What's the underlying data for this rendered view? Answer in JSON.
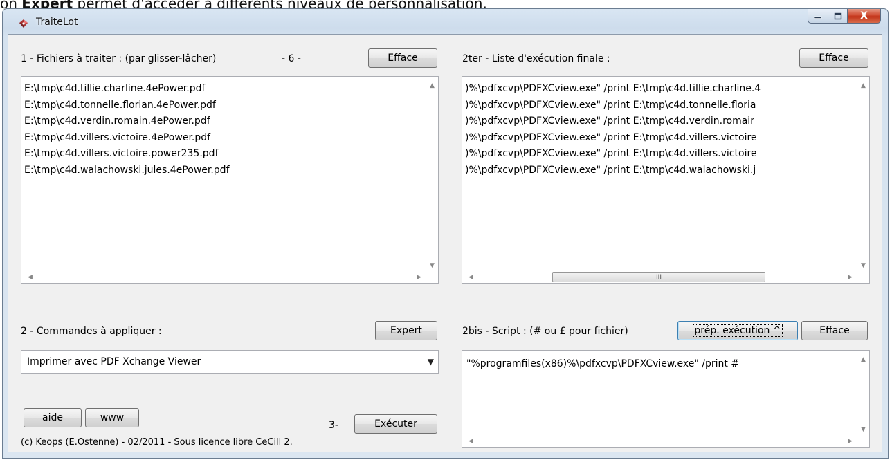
{
  "doc_line": {
    "prefix": "on ",
    "bold": "Expert",
    "suffix": " permet d'accéder à différents niveaux de personnalisation."
  },
  "window": {
    "title": "TraiteLot",
    "close_glyph": "X"
  },
  "files_panel": {
    "label": "1 - Fichiers à traiter : (par glisser-lâcher)",
    "count": "- 6 -",
    "clear_button": "Efface",
    "items": [
      "E:\\tmp\\c4d.tillie.charline.4ePower.pdf",
      "E:\\tmp\\c4d.tonnelle.florian.4ePower.pdf",
      "E:\\tmp\\c4d.verdin.romain.4ePower.pdf",
      "E:\\tmp\\c4d.villers.victoire.4ePower.pdf",
      "E:\\tmp\\c4d.villers.victoire.power235.pdf",
      "E:\\tmp\\c4d.walachowski.jules.4ePower.pdf"
    ]
  },
  "final_panel": {
    "label": "2ter - Liste d'exécution finale :",
    "clear_button": "Efface",
    "items": [
      ")%\\pdfxcvp\\PDFXCview.exe\" /print E:\\tmp\\c4d.tillie.charline.4",
      ")%\\pdfxcvp\\PDFXCview.exe\" /print E:\\tmp\\c4d.tonnelle.floria",
      ")%\\pdfxcvp\\PDFXCview.exe\" /print E:\\tmp\\c4d.verdin.romair",
      ")%\\pdfxcvp\\PDFXCview.exe\" /print E:\\tmp\\c4d.villers.victoire",
      ")%\\pdfxcvp\\PDFXCview.exe\" /print E:\\tmp\\c4d.villers.victoire",
      ")%\\pdfxcvp\\PDFXCview.exe\" /print E:\\tmp\\c4d.walachowski.j"
    ],
    "thumb_glyph": "III"
  },
  "commands_panel": {
    "label": "2 - Commandes à appliquer :",
    "expert_button": "Expert",
    "selected": "Imprimer avec PDF Xchange Viewer"
  },
  "script_panel": {
    "label": "2bis - Script : (# ou £ pour fichier)",
    "prep_button": "prép. exécution ^",
    "clear_button": "Efface",
    "content": "\"%programfiles(x86)%\\pdfxcvp\\PDFXCview.exe\" /print #"
  },
  "footer": {
    "help_button": "aide",
    "www_button": "www",
    "step_label": "3-",
    "run_button": "Exécuter",
    "copyright": "(c) Keops (E.Ostenne) - 02/2011 - Sous licence libre CeCill 2."
  }
}
